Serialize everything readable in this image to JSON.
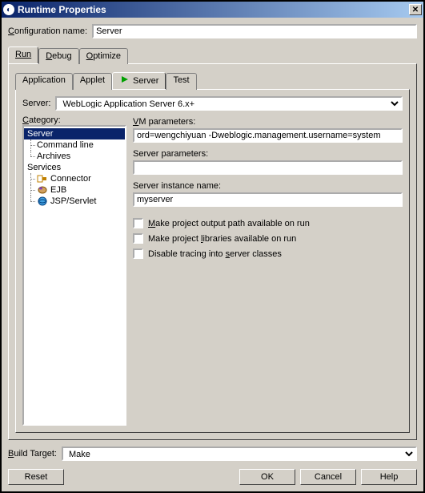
{
  "title": "Runtime Properties",
  "config_label_pre": "C",
  "config_label_rest": "onfiguration name:",
  "config_value": "Server",
  "tabs": {
    "run": "Run",
    "debug_pre": "D",
    "debug_rest": "ebug",
    "optimize_pre": "O",
    "optimize_rest": "ptimize"
  },
  "inner_tabs": {
    "application": "Application",
    "applet": "Applet",
    "server": "Server",
    "test": "Test"
  },
  "server_label": "Server:",
  "server_value": "WebLogic Application Server 6.x+",
  "category_label_pre": "C",
  "category_label_rest": "ategory:",
  "tree": {
    "server": "Server",
    "command_line": "Command line",
    "archives": "Archives",
    "services": "Services",
    "connector": "Connector",
    "ejb": "EJB",
    "jsp": "JSP/Servlet"
  },
  "params": {
    "vm_label_pre": "V",
    "vm_label_rest": "M parameters:",
    "vm_value": "ord=wengchiyuan -Dweblogic.management.username=system",
    "server_params_label": "Server parameters:",
    "server_params_value": "",
    "instance_label": "Server instance name:",
    "instance_value": "myserver",
    "chk1_pre": "M",
    "chk1_rest": "ake project output path available on run",
    "chk2_pre": "Make project ",
    "chk2_u": "l",
    "chk2_rest": "ibraries available on run",
    "chk3_pre": "Disable tracing into ",
    "chk3_u": "s",
    "chk3_rest": "erver classes"
  },
  "build_label_pre": "B",
  "build_label_rest": "uild Target:",
  "build_value": "Make",
  "buttons": {
    "reset": "Reset",
    "ok": "OK",
    "cancel": "Cancel",
    "help": "Help"
  }
}
